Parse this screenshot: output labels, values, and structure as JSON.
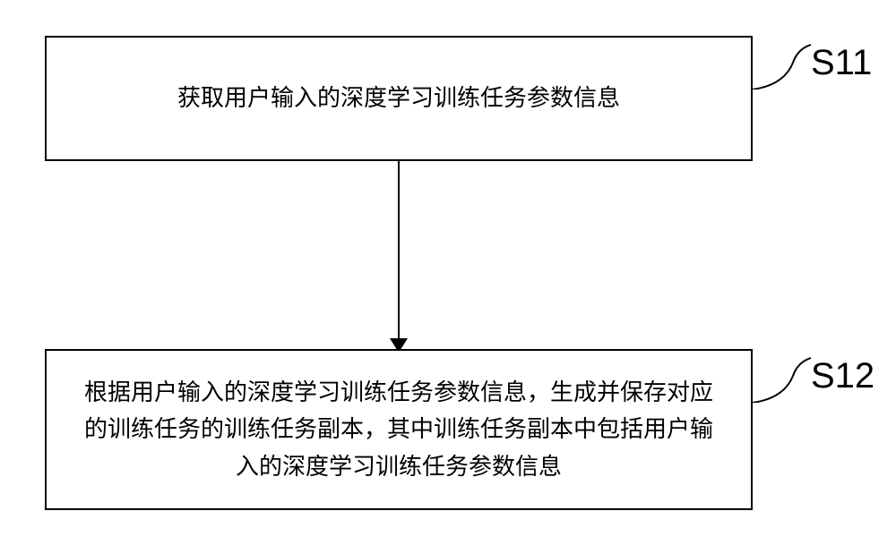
{
  "flowchart": {
    "steps": [
      {
        "id": "S11",
        "text": "获取用户输入的深度学习训练任务参数信息"
      },
      {
        "id": "S12",
        "text": "根据用户输入的深度学习训练任务参数信息，生成并保存对应的训练任务的训练任务副本，其中训练任务副本中包括用户输入的深度学习训练任务参数信息"
      }
    ]
  }
}
